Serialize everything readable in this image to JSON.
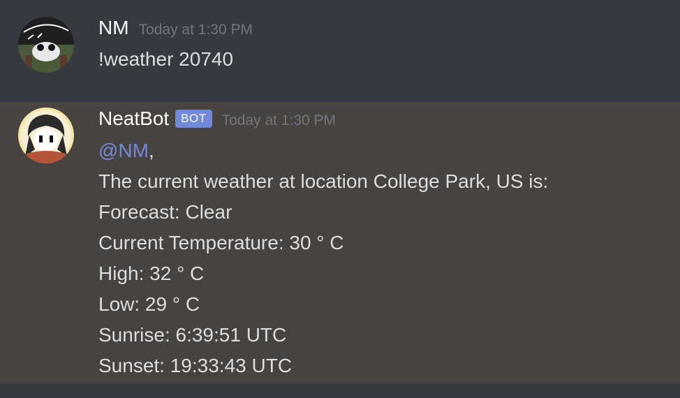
{
  "messages": [
    {
      "author": "NM",
      "timestamp": "Today at 1:30 PM",
      "text": "!weather 20740"
    },
    {
      "author": "NeatBot",
      "bot_tag": "BOT",
      "timestamp": "Today at 1:30 PM",
      "mention": "@NM",
      "mention_suffix": ",",
      "lines": [
        "The current weather at location College Park, US is:",
        "Forecast: Clear",
        "Current Temperature: 30 ° C",
        "High: 32 ° C",
        "Low: 29 ° C",
        "Sunrise: 6:39:51 UTC",
        "Sunset: 19:33:43 UTC"
      ]
    }
  ]
}
